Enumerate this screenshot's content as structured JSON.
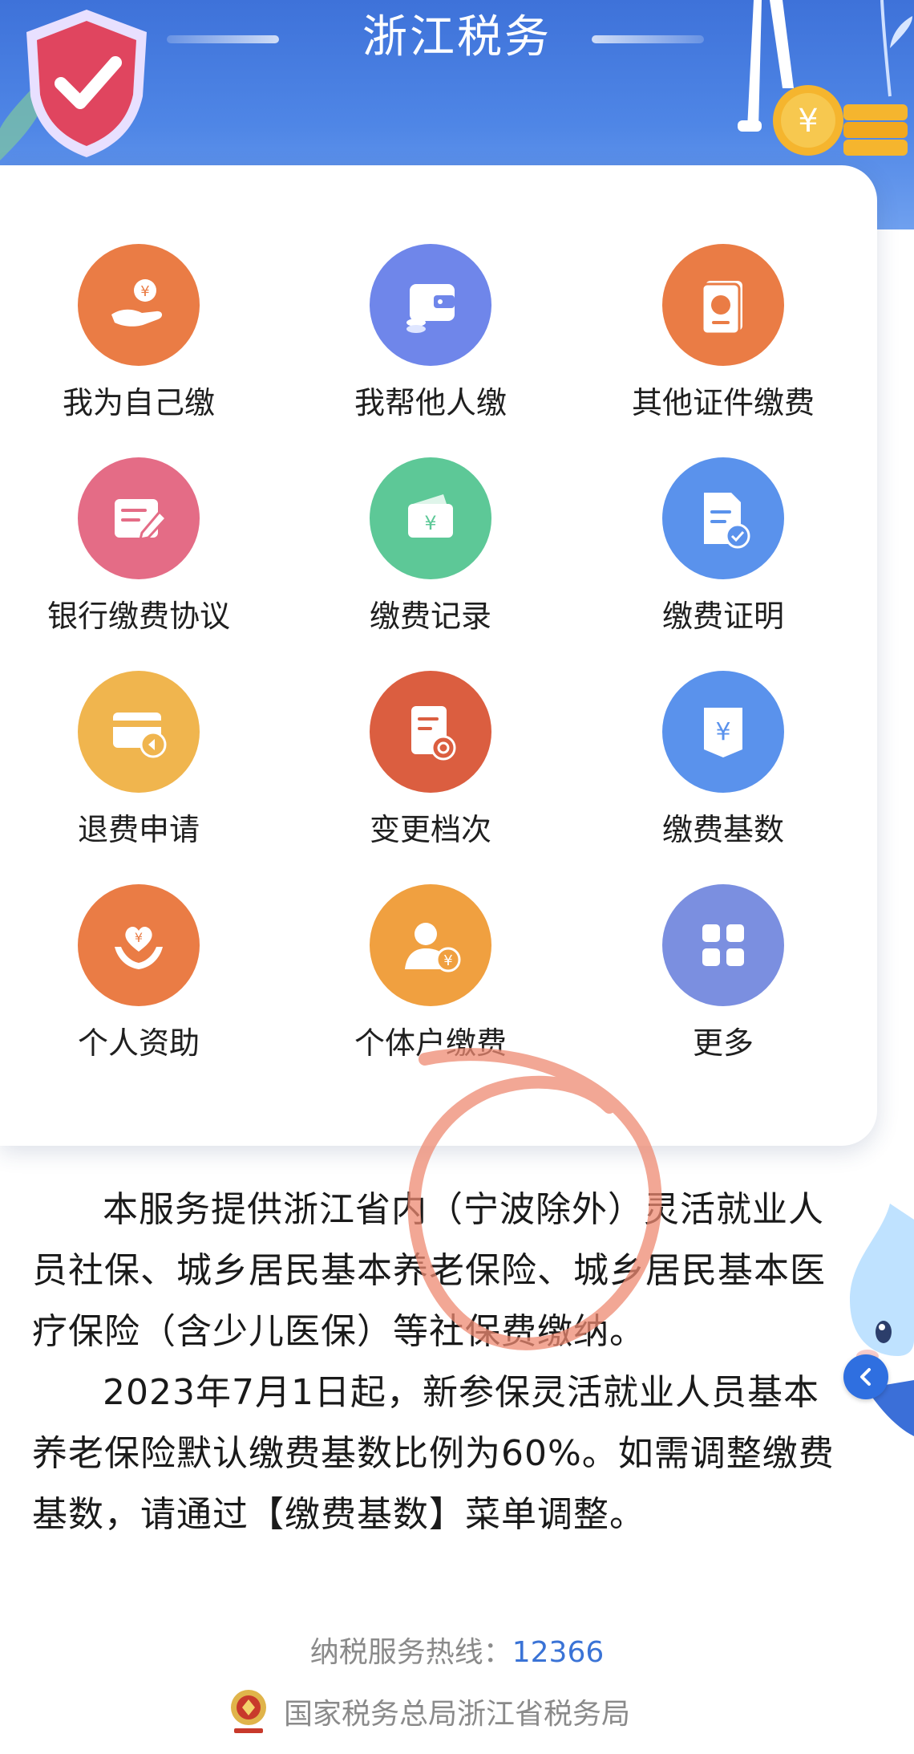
{
  "header": {
    "title": "浙江税务"
  },
  "menu": {
    "items": [
      {
        "label": "我为自己缴",
        "icon": "hand-yuan-icon",
        "color": "#ea7c45"
      },
      {
        "label": "我帮他人缴",
        "icon": "wallet-coins-icon",
        "color": "#6f86ea"
      },
      {
        "label": "其他证件缴费",
        "icon": "passport-icon",
        "color": "#ea7c45"
      },
      {
        "label": "银行缴费协议",
        "icon": "document-edit-icon",
        "color": "#e46c86"
      },
      {
        "label": "缴费记录",
        "icon": "wallet-yuan-icon",
        "color": "#5dc897"
      },
      {
        "label": "缴费证明",
        "icon": "certificate-check-icon",
        "color": "#5a92ec"
      },
      {
        "label": "退费申请",
        "icon": "card-refund-icon",
        "color": "#f0b54e"
      },
      {
        "label": "变更档次",
        "icon": "document-change-icon",
        "color": "#db5e40"
      },
      {
        "label": "缴费基数",
        "icon": "yuan-tag-icon",
        "color": "#5a92ec"
      },
      {
        "label": "个人资助",
        "icon": "heart-hands-icon",
        "color": "#ea7c45"
      },
      {
        "label": "个体户缴费",
        "icon": "person-yuan-icon",
        "color": "#f0a040"
      },
      {
        "label": "更多",
        "icon": "grid-more-icon",
        "color": "#7b8fe0"
      }
    ]
  },
  "description": {
    "paragraph1": "本服务提供浙江省内（宁波除外）灵活就业人员社保、城乡居民基本养老保险、城乡居民基本医疗保险（含少儿医保）等社保费缴纳。",
    "paragraph2": "2023年7月1日起，新参保灵活就业人员基本养老保险默认缴费基数比例为60%。如需调整缴费基数，请通过【缴费基数】菜单调整。"
  },
  "footer": {
    "hotline_label": "纳税服务热线：",
    "hotline_number": "12366",
    "bureau_name": "国家税务总局浙江省税务局"
  }
}
